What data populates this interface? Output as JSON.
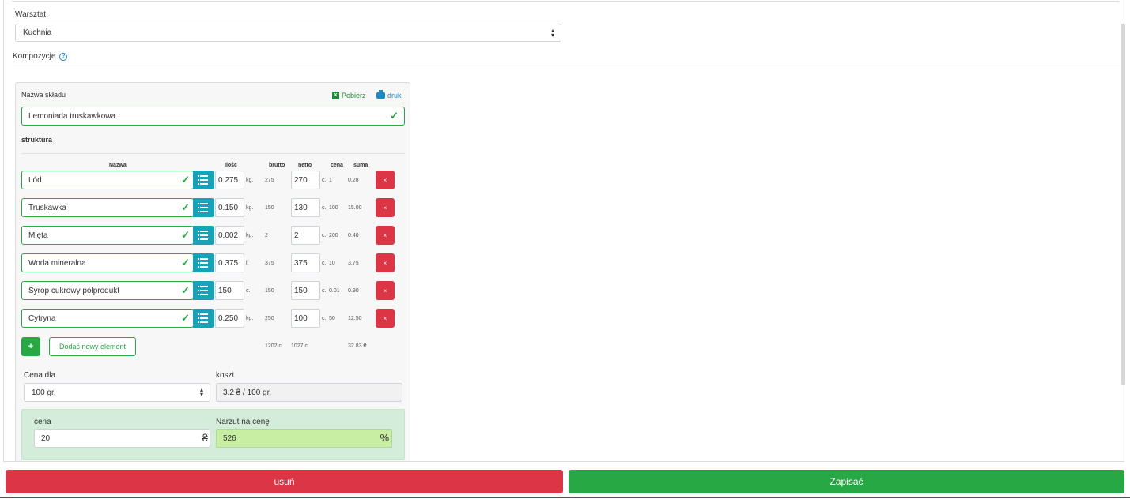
{
  "workshop": {
    "label": "Warsztat",
    "value": "Kuchnia"
  },
  "compositions": {
    "label": "Kompozycje",
    "help_glyph": "?"
  },
  "card": {
    "name_label": "Nazwa składu",
    "download_label": "Pobierz",
    "print_label": "druk",
    "name_value": "Lemoniada truskawkowa",
    "structure_label": "struktura",
    "columns": {
      "name": "Nazwa",
      "qty": "Ilość",
      "gross": "brutto",
      "net": "netto",
      "price": "cena",
      "sum": "suma"
    },
    "rows": [
      {
        "name": "Lód",
        "qty": "0.275",
        "unit": "kg.",
        "gross": "275",
        "net": "270",
        "net_unit": "c.",
        "price": "1",
        "sum": "0.28"
      },
      {
        "name": "Truskawka",
        "qty": "0.150",
        "unit": "kg.",
        "gross": "150",
        "net": "130",
        "net_unit": "c.",
        "price": "100",
        "sum": "15.00"
      },
      {
        "name": "Mięta",
        "qty": "0.002",
        "unit": "kg.",
        "gross": "2",
        "net": "2",
        "net_unit": "c.",
        "price": "200",
        "sum": "0.40"
      },
      {
        "name": "Woda mineralna",
        "qty": "0.375",
        "unit": "l.",
        "gross": "375",
        "net": "375",
        "net_unit": "c.",
        "price": "10",
        "sum": "3.75"
      },
      {
        "name": "Syrop cukrowy półprodukt",
        "qty": "150",
        "unit": "c.",
        "gross": "150",
        "net": "150",
        "net_unit": "c.",
        "price": "0.01",
        "sum": "0.90"
      },
      {
        "name": "Cytryna",
        "qty": "0.250",
        "unit": "kg.",
        "gross": "250",
        "net": "100",
        "net_unit": "c.",
        "price": "50",
        "sum": "12.50"
      }
    ],
    "delete_glyph": "×",
    "add_glyph": "+",
    "add_label": "Dodać nowy element",
    "totals": {
      "gross": "1202 c.",
      "net": "1027 c.",
      "sum": "32.83 ₴"
    },
    "price_for_label": "Cena dla",
    "price_for_value": "100 gr.",
    "cost_label": "koszt",
    "cost_value": "3.2 ₴ / 100 gr.",
    "price_label": "cena",
    "price_value": "20",
    "price_suffix": "₴",
    "markup_label": "Narzut na cenę",
    "markup_value": "526",
    "markup_suffix": "%"
  },
  "actions": {
    "delete_label": "usuń",
    "save_label": "Zapisać"
  },
  "colors": {
    "success": "#28a745",
    "danger": "#dc3545",
    "info": "#17a2b8",
    "highlight": "#c7eea3"
  }
}
